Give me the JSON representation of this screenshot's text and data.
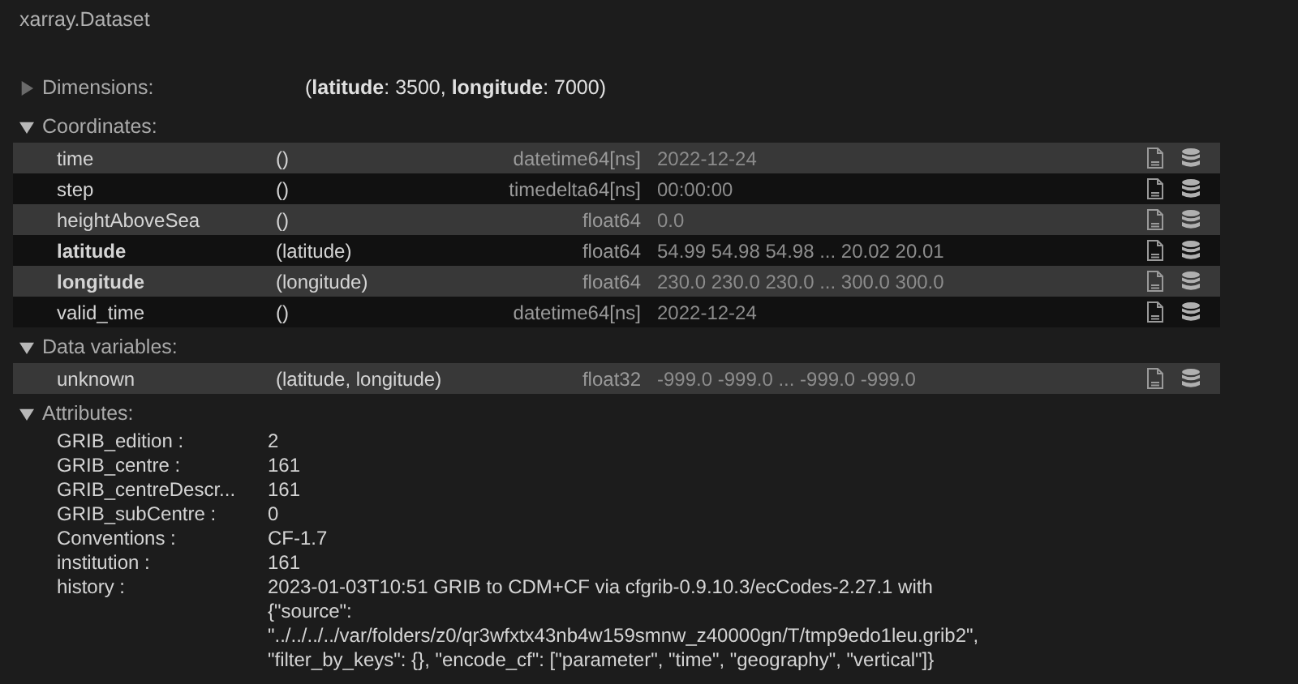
{
  "title": "xarray.Dataset",
  "sections": [
    {
      "kind": "dims",
      "label": "Dimensions:",
      "expanded": false,
      "value": "(**latitude**: 3500,  **longitude**: 7000)"
    },
    {
      "kind": "vars",
      "label": "Coordinates:",
      "expanded": true,
      "rows": [
        {
          "name": "time",
          "dims": "()",
          "dtype": "datetime64[ns]",
          "preview": "2022-12-24",
          "indexed": false
        },
        {
          "name": "step",
          "dims": "()",
          "dtype": "timedelta64[ns]",
          "preview": "00:00:00",
          "indexed": false
        },
        {
          "name": "heightAboveSea",
          "dims": "()",
          "dtype": "float64",
          "preview": "0.0",
          "indexed": false
        },
        {
          "name": "latitude",
          "dims": "(latitude)",
          "dtype": "float64",
          "preview": "54.99 54.98 54.98 ... 20.02 20.01",
          "indexed": true
        },
        {
          "name": "longitude",
          "dims": "(longitude)",
          "dtype": "float64",
          "preview": "230.0 230.0 230.0 ... 300.0 300.0",
          "indexed": true
        },
        {
          "name": "valid_time",
          "dims": "()",
          "dtype": "datetime64[ns]",
          "preview": "2022-12-24",
          "indexed": false
        }
      ]
    },
    {
      "kind": "vars",
      "label": "Data variables:",
      "expanded": true,
      "rows": [
        {
          "name": "unknown",
          "dims": "(latitude, longitude)",
          "dtype": "float32",
          "preview": "-999.0 -999.0 ... -999.0 -999.0",
          "indexed": false
        }
      ]
    },
    {
      "kind": "attrs",
      "label": "Attributes:",
      "expanded": true,
      "attrs": [
        {
          "key": "GRIB_edition :",
          "value": "2"
        },
        {
          "key": "GRIB_centre :",
          "value": "161"
        },
        {
          "key": "GRIB_centreDescr...",
          "value": "161"
        },
        {
          "key": "GRIB_subCentre :",
          "value": "0"
        },
        {
          "key": "Conventions :",
          "value": "CF-1.7"
        },
        {
          "key": "institution :",
          "value": "161"
        },
        {
          "key": "history :",
          "value": "2023-01-03T10:51 GRIB to CDM+CF via cfgrib-0.9.10.3/ecCodes-2.27.1 with {\"source\": \"../../../../var/folders/z0/qr3wfxtx43nb4w159smnw_z40000gn/T/tmp9edo1leu.grib2\", \"filter_by_keys\": {}, \"encode_cf\": [\"parameter\", \"time\", \"geography\", \"vertical\"]}"
        }
      ]
    }
  ]
}
